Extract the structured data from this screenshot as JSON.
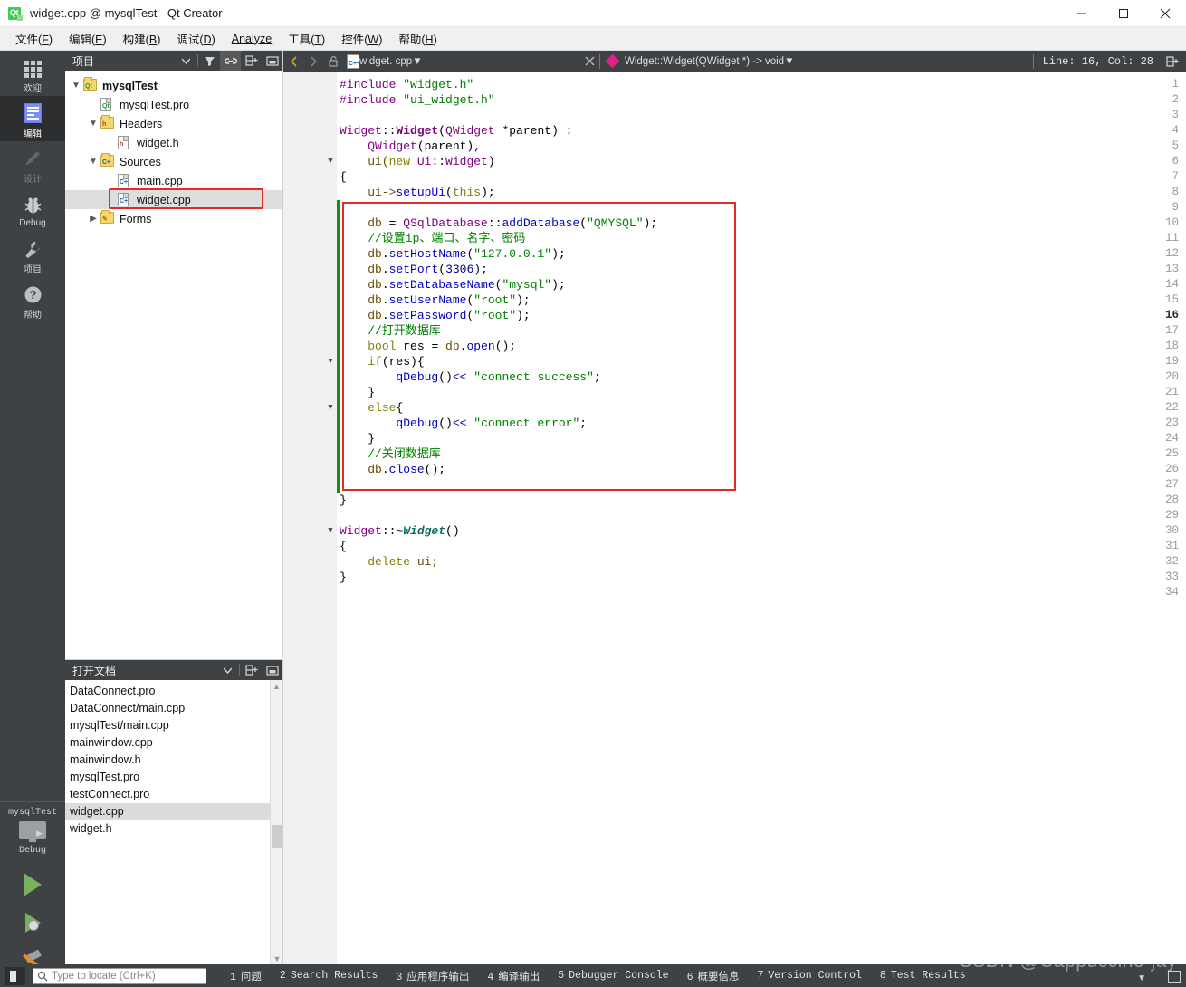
{
  "window": {
    "title": "widget.cpp @ mysqlTest - Qt Creator",
    "app_icon": "qt-logo-icon",
    "minimize": "—",
    "maximize": "□",
    "close": "✕"
  },
  "menubar": {
    "items": [
      {
        "label": "文件(F)",
        "name": "menu-file"
      },
      {
        "label": "编辑(E)",
        "name": "menu-edit"
      },
      {
        "label": "构建(B)",
        "name": "menu-build"
      },
      {
        "label": "调试(D)",
        "name": "menu-debug"
      },
      {
        "label": "Analyze",
        "name": "menu-analyze"
      },
      {
        "label": "工具(T)",
        "name": "menu-tools"
      },
      {
        "label": "控件(W)",
        "name": "menu-window"
      },
      {
        "label": "帮助(H)",
        "name": "menu-help"
      }
    ]
  },
  "modebar": {
    "items": [
      {
        "label": "欢迎",
        "icon": "grid-icon",
        "active": false,
        "disabled": false
      },
      {
        "label": "编辑",
        "icon": "document-lines-icon",
        "active": true,
        "disabled": false
      },
      {
        "label": "设计",
        "icon": "pencil-icon",
        "active": false,
        "disabled": true
      },
      {
        "label": "Debug",
        "icon": "bug-icon",
        "active": false,
        "disabled": false
      },
      {
        "label": "项目",
        "icon": "wrench-icon",
        "active": false,
        "disabled": false
      },
      {
        "label": "帮助",
        "icon": "question-circle-icon",
        "active": false,
        "disabled": false
      }
    ],
    "run_area": {
      "kit_name": "mysqlTest",
      "kit_config": "Debug",
      "run_button": "run-icon",
      "debug_button": "run-debug-icon",
      "build_button": "hammer-icon"
    }
  },
  "project_panel": {
    "title": "项目",
    "toolbar": [
      {
        "name": "project-selector-dropdown",
        "icon": "chevron-down-icon"
      },
      {
        "name": "filter-button",
        "icon": "filter-icon"
      },
      {
        "name": "sync-with-editor-button",
        "icon": "link-icon",
        "active": true
      },
      {
        "name": "split-button",
        "icon": "split-icon"
      },
      {
        "name": "close-panel-button",
        "icon": "minimize-panel-icon"
      }
    ],
    "tree": [
      {
        "label": "mysqlTest",
        "indent": 0,
        "chev": "v",
        "icon": "qt-project-icon",
        "bold": true,
        "selected": false,
        "highlighted": false
      },
      {
        "label": "mysqlTest.pro",
        "indent": 1,
        "chev": "",
        "icon": "qt-pro-file-icon",
        "bold": false,
        "selected": false,
        "highlighted": false
      },
      {
        "label": "Headers",
        "indent": 1,
        "chev": "v",
        "icon": "headers-folder-icon",
        "bold": false,
        "selected": false,
        "highlighted": false
      },
      {
        "label": "widget.h",
        "indent": 2,
        "chev": "",
        "icon": "h-file-icon",
        "bold": false,
        "selected": false,
        "highlighted": false
      },
      {
        "label": "Sources",
        "indent": 1,
        "chev": "v",
        "icon": "sources-folder-icon",
        "bold": false,
        "selected": false,
        "highlighted": false
      },
      {
        "label": "main.cpp",
        "indent": 2,
        "chev": "",
        "icon": "cpp-file-icon",
        "bold": false,
        "selected": false,
        "highlighted": false
      },
      {
        "label": "widget.cpp",
        "indent": 2,
        "chev": "",
        "icon": "cpp-file-icon",
        "bold": false,
        "selected": true,
        "highlighted": true
      },
      {
        "label": "Forms",
        "indent": 1,
        "chev": ">",
        "icon": "forms-folder-icon",
        "bold": false,
        "selected": false,
        "highlighted": false
      }
    ]
  },
  "open_documents": {
    "title": "打开文档",
    "toolbar": [
      {
        "name": "documents-dropdown",
        "icon": "chevron-down-icon"
      },
      {
        "name": "split-button",
        "icon": "split-icon"
      },
      {
        "name": "close-panel-button",
        "icon": "minimize-panel-icon"
      }
    ],
    "items": [
      {
        "label": "DataConnect.pro",
        "selected": false
      },
      {
        "label": "DataConnect/main.cpp",
        "selected": false
      },
      {
        "label": "mysqlTest/main.cpp",
        "selected": false
      },
      {
        "label": "mainwindow.cpp",
        "selected": false
      },
      {
        "label": "mainwindow.h",
        "selected": false
      },
      {
        "label": "mysqlTest.pro",
        "selected": false
      },
      {
        "label": "testConnect.pro",
        "selected": false
      },
      {
        "label": "widget.cpp",
        "selected": true
      },
      {
        "label": "widget.h",
        "selected": false
      }
    ]
  },
  "editor": {
    "toolbar": {
      "back": "chevron-left-icon",
      "forward": "chevron-right-icon",
      "lock": "unlock-icon",
      "file_icon": "cpp-file-icon",
      "file_name": "widget. cpp",
      "file_dropdown": "chevron-down-icon",
      "close_button": "close-icon",
      "symbol_icon": "diamond-icon",
      "symbol_name": "Widget::Widget(QWidget *) -> void",
      "symbol_dropdown": "chevron-down-icon",
      "line_col": "Line: 16, Col: 28",
      "split_button": "split-icon"
    },
    "current_line": 16,
    "total_lines": 34,
    "fold_markers": [
      6,
      19,
      22,
      30
    ],
    "change_bar_lines": [
      9,
      10,
      11,
      12,
      13,
      14,
      15,
      16,
      17,
      18,
      19,
      20,
      21,
      22,
      23,
      24,
      25,
      26,
      27
    ],
    "annotation_box": {
      "color": "#e02b26",
      "from_line": 9,
      "to_line": 27
    },
    "lines": [
      {
        "n": 1,
        "tokens": [
          {
            "t": "#include ",
            "c": "pp"
          },
          {
            "t": "\"widget.h\"",
            "c": "str"
          }
        ]
      },
      {
        "n": 2,
        "tokens": [
          {
            "t": "#include ",
            "c": "pp"
          },
          {
            "t": "\"ui_widget.h\"",
            "c": "str"
          }
        ]
      },
      {
        "n": 3,
        "tokens": []
      },
      {
        "n": 4,
        "tokens": [
          {
            "t": "Widget",
            "c": "cls"
          },
          {
            "t": "::",
            "c": "op"
          },
          {
            "t": "Widget",
            "c": "clsb"
          },
          {
            "t": "(",
            "c": "op"
          },
          {
            "t": "QWidget",
            "c": "cls"
          },
          {
            "t": " *parent) :",
            "c": "op"
          }
        ]
      },
      {
        "n": 5,
        "tokens": [
          {
            "t": "    ",
            "c": "op"
          },
          {
            "t": "QWidget",
            "c": "cls"
          },
          {
            "t": "(parent),",
            "c": "op"
          }
        ]
      },
      {
        "n": 6,
        "tokens": [
          {
            "t": "    ui(",
            "c": "fld"
          },
          {
            "t": "new",
            "c": "kw"
          },
          {
            "t": " ",
            "c": "op"
          },
          {
            "t": "Ui",
            "c": "cls"
          },
          {
            "t": "::",
            "c": "op"
          },
          {
            "t": "Widget",
            "c": "cls"
          },
          {
            "t": ")",
            "c": "op"
          }
        ]
      },
      {
        "n": 7,
        "tokens": [
          {
            "t": "{",
            "c": "op"
          }
        ]
      },
      {
        "n": 8,
        "tokens": [
          {
            "t": "    ui->",
            "c": "fld"
          },
          {
            "t": "setupUi",
            "c": "fn"
          },
          {
            "t": "(",
            "c": "op"
          },
          {
            "t": "this",
            "c": "kw"
          },
          {
            "t": ");",
            "c": "op"
          }
        ]
      },
      {
        "n": 9,
        "tokens": []
      },
      {
        "n": 10,
        "tokens": [
          {
            "t": "    ",
            "c": "op"
          },
          {
            "t": "db",
            "c": "fld"
          },
          {
            "t": " = ",
            "c": "op"
          },
          {
            "t": "QSqlDatabase",
            "c": "cls"
          },
          {
            "t": "::",
            "c": "op"
          },
          {
            "t": "addDatabase",
            "c": "fn"
          },
          {
            "t": "(",
            "c": "op"
          },
          {
            "t": "\"QMYSQL\"",
            "c": "str"
          },
          {
            "t": ");",
            "c": "op"
          }
        ]
      },
      {
        "n": 11,
        "tokens": [
          {
            "t": "    //设置ip、端口、名字、密码",
            "c": "cmt"
          }
        ]
      },
      {
        "n": 12,
        "tokens": [
          {
            "t": "    ",
            "c": "op"
          },
          {
            "t": "db",
            "c": "fld"
          },
          {
            "t": ".",
            "c": "op"
          },
          {
            "t": "setHostName",
            "c": "fn"
          },
          {
            "t": "(",
            "c": "op"
          },
          {
            "t": "\"127.0.0.1\"",
            "c": "str"
          },
          {
            "t": ");",
            "c": "op"
          }
        ]
      },
      {
        "n": 13,
        "tokens": [
          {
            "t": "    ",
            "c": "op"
          },
          {
            "t": "db",
            "c": "fld"
          },
          {
            "t": ".",
            "c": "op"
          },
          {
            "t": "setPort",
            "c": "fn"
          },
          {
            "t": "(",
            "c": "op"
          },
          {
            "t": "3306",
            "c": "num"
          },
          {
            "t": ");",
            "c": "op"
          }
        ]
      },
      {
        "n": 14,
        "tokens": [
          {
            "t": "    ",
            "c": "op"
          },
          {
            "t": "db",
            "c": "fld"
          },
          {
            "t": ".",
            "c": "op"
          },
          {
            "t": "setDatabaseName",
            "c": "fn"
          },
          {
            "t": "(",
            "c": "op"
          },
          {
            "t": "\"mysql\"",
            "c": "str"
          },
          {
            "t": ");",
            "c": "op"
          }
        ]
      },
      {
        "n": 15,
        "tokens": [
          {
            "t": "    ",
            "c": "op"
          },
          {
            "t": "db",
            "c": "fld"
          },
          {
            "t": ".",
            "c": "op"
          },
          {
            "t": "setUserName",
            "c": "fn"
          },
          {
            "t": "(",
            "c": "op"
          },
          {
            "t": "\"root\"",
            "c": "str"
          },
          {
            "t": ");",
            "c": "op"
          }
        ]
      },
      {
        "n": 16,
        "tokens": [
          {
            "t": "    ",
            "c": "op"
          },
          {
            "t": "db",
            "c": "fld"
          },
          {
            "t": ".",
            "c": "op"
          },
          {
            "t": "setPassword",
            "c": "fn"
          },
          {
            "t": "(",
            "c": "op"
          },
          {
            "t": "\"root\"",
            "c": "str"
          },
          {
            "t": ");",
            "c": "op"
          }
        ]
      },
      {
        "n": 17,
        "tokens": [
          {
            "t": "    //打开数据库",
            "c": "cmt"
          }
        ]
      },
      {
        "n": 18,
        "tokens": [
          {
            "t": "    ",
            "c": "op"
          },
          {
            "t": "bool",
            "c": "kw"
          },
          {
            "t": " res = ",
            "c": "op"
          },
          {
            "t": "db",
            "c": "fld"
          },
          {
            "t": ".",
            "c": "op"
          },
          {
            "t": "open",
            "c": "fn"
          },
          {
            "t": "();",
            "c": "op"
          }
        ]
      },
      {
        "n": 19,
        "tokens": [
          {
            "t": "    ",
            "c": "op"
          },
          {
            "t": "if",
            "c": "kw"
          },
          {
            "t": "(res){",
            "c": "op"
          }
        ]
      },
      {
        "n": 20,
        "tokens": [
          {
            "t": "        ",
            "c": "op"
          },
          {
            "t": "qDebug",
            "c": "fn"
          },
          {
            "t": "()",
            "c": "op"
          },
          {
            "t": "<<",
            "c": "op2"
          },
          {
            "t": " ",
            "c": "op"
          },
          {
            "t": "\"connect success\"",
            "c": "str"
          },
          {
            "t": ";",
            "c": "op"
          }
        ]
      },
      {
        "n": 21,
        "tokens": [
          {
            "t": "    }",
            "c": "op"
          }
        ]
      },
      {
        "n": 22,
        "tokens": [
          {
            "t": "    ",
            "c": "op"
          },
          {
            "t": "else",
            "c": "kw"
          },
          {
            "t": "{",
            "c": "op"
          }
        ]
      },
      {
        "n": 23,
        "tokens": [
          {
            "t": "        ",
            "c": "op"
          },
          {
            "t": "qDebug",
            "c": "fn"
          },
          {
            "t": "()",
            "c": "op"
          },
          {
            "t": "<<",
            "c": "op2"
          },
          {
            "t": " ",
            "c": "op"
          },
          {
            "t": "\"connect error\"",
            "c": "str"
          },
          {
            "t": ";",
            "c": "op"
          }
        ]
      },
      {
        "n": 24,
        "tokens": [
          {
            "t": "    }",
            "c": "op"
          }
        ]
      },
      {
        "n": 25,
        "tokens": [
          {
            "t": "    //关闭数据库",
            "c": "cmt"
          }
        ]
      },
      {
        "n": 26,
        "tokens": [
          {
            "t": "    ",
            "c": "op"
          },
          {
            "t": "db",
            "c": "fld"
          },
          {
            "t": ".",
            "c": "op"
          },
          {
            "t": "close",
            "c": "fn"
          },
          {
            "t": "();",
            "c": "op"
          }
        ]
      },
      {
        "n": 27,
        "tokens": []
      },
      {
        "n": 28,
        "tokens": [
          {
            "t": "}",
            "c": "op"
          }
        ]
      },
      {
        "n": 29,
        "tokens": []
      },
      {
        "n": 30,
        "tokens": [
          {
            "t": "Widget",
            "c": "cls"
          },
          {
            "t": "::~",
            "c": "op"
          },
          {
            "t": "Widget",
            "c": "ital"
          },
          {
            "t": "()",
            "c": "op"
          }
        ]
      },
      {
        "n": 31,
        "tokens": [
          {
            "t": "{",
            "c": "op"
          }
        ]
      },
      {
        "n": 32,
        "tokens": [
          {
            "t": "    ",
            "c": "op"
          },
          {
            "t": "delete",
            "c": "kw"
          },
          {
            "t": " ui;",
            "c": "fld"
          }
        ]
      },
      {
        "n": 33,
        "tokens": [
          {
            "t": "}",
            "c": "op"
          }
        ]
      },
      {
        "n": 34,
        "tokens": []
      }
    ]
  },
  "statusbar": {
    "sidebar_toggle": "sidebar-toggle-icon",
    "locator": {
      "icon": "search-icon",
      "placeholder": "Type to locate (Ctrl+K)",
      "value": ""
    },
    "output_tabs": [
      {
        "num": "1",
        "label": "问题"
      },
      {
        "num": "2",
        "label": "Search Results"
      },
      {
        "num": "3",
        "label": "应用程序输出"
      },
      {
        "num": "4",
        "label": "编译输出"
      },
      {
        "num": "5",
        "label": "Debugger Console"
      },
      {
        "num": "6",
        "label": "概要信息"
      },
      {
        "num": "7",
        "label": "Version Control"
      },
      {
        "num": "8",
        "label": "Test Results"
      }
    ],
    "watermark": "CSDN @Cappuccino-jay"
  },
  "colors": {
    "accent_green": "#41cd52",
    "annotation_red": "#e02b26",
    "change_bar_green": "#1d8a1d",
    "chrome_dark": "#3f4244",
    "mode_active": "#2c2e30"
  }
}
